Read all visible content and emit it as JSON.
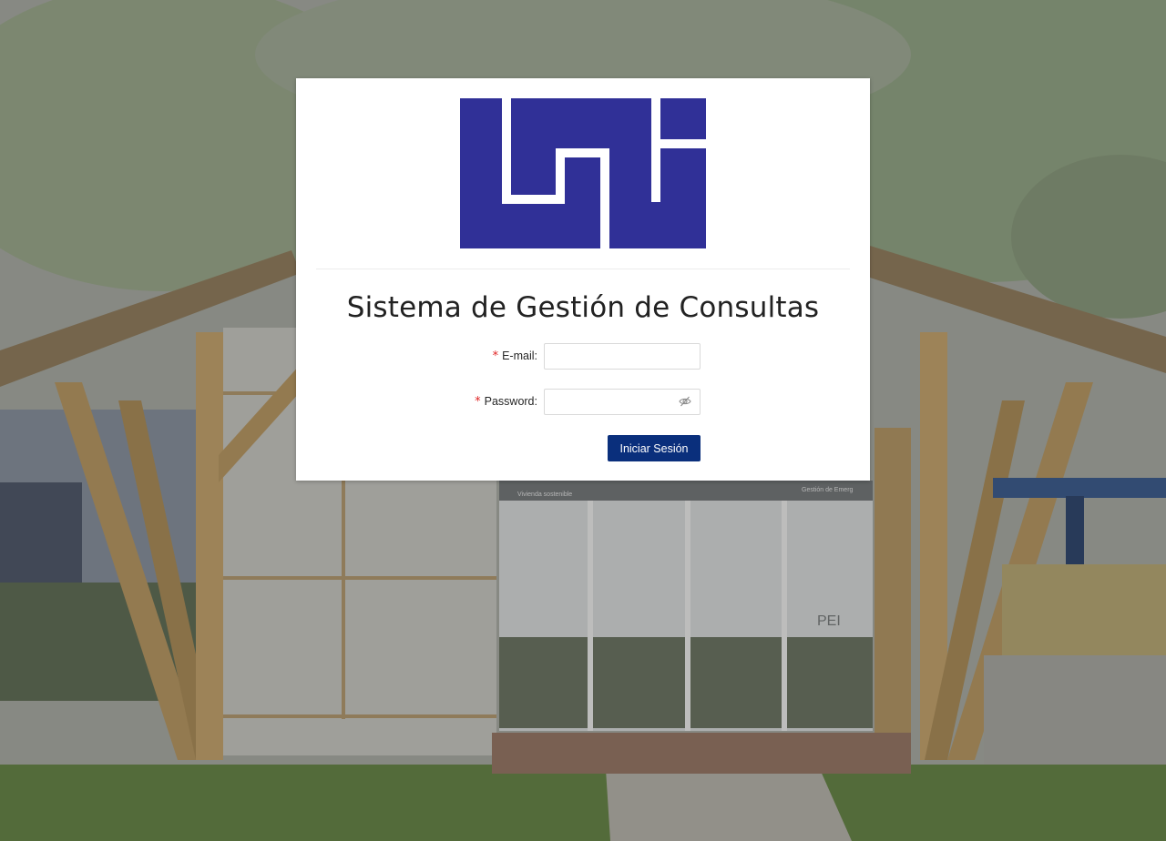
{
  "login": {
    "title": "Sistema de Gestión de Consultas",
    "email_label": "E-mail",
    "email_value": "",
    "email_placeholder": "",
    "password_label": "Password",
    "password_value": "",
    "password_placeholder": "",
    "required_marker": "*",
    "label_suffix": ":",
    "submit_label": "Iniciar Sesión"
  },
  "colors": {
    "logo_blue": "#303097",
    "button_blue": "#0a2f7c",
    "required_red": "#e02424"
  },
  "icons": {
    "password_toggle": "eye-invisible-icon"
  },
  "background": {
    "signage": [
      "Vivienda sostenible",
      "Gestión de Emerg",
      "PEI"
    ]
  }
}
